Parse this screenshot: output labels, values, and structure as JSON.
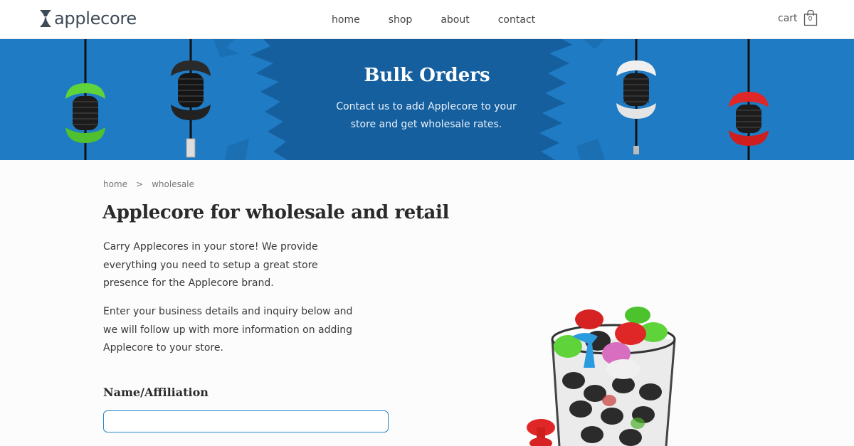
{
  "header": {
    "logo_text": "applecore",
    "nav": [
      {
        "label": "home"
      },
      {
        "label": "shop"
      },
      {
        "label": "about"
      },
      {
        "label": "contact"
      }
    ],
    "cart_label": "cart",
    "cart_count": "0"
  },
  "hero": {
    "title": "Bulk Orders",
    "subtitle": "Contact us to add Applecore to your store and get wholesale rates."
  },
  "breadcrumb": {
    "home": "home",
    "separator": ">",
    "current": "wholesale"
  },
  "main": {
    "title": "Applecore for wholesale and retail",
    "paragraph_1": "Carry Applecores in your store! We provide everything you need to setup a great store presence for the Applecore brand.",
    "paragraph_2": "Enter your business details and inquiry below and we will follow up with more information on adding Applecore to your store.",
    "form": {
      "name_label": "Name/Affiliation",
      "name_value": "",
      "name_placeholder": ""
    }
  },
  "colors": {
    "hero_blue": "#1f7bc4",
    "hero_dark_blue": "#155f9e",
    "accent_input_border": "#2a86c9",
    "gizmo_green": "#5fd33a",
    "gizmo_red": "#e02727",
    "gizmo_black": "#2a2a2a",
    "gizmo_white": "#f0f0f0",
    "gizmo_blue": "#2b9be0",
    "gizmo_pink": "#d86ec0"
  }
}
